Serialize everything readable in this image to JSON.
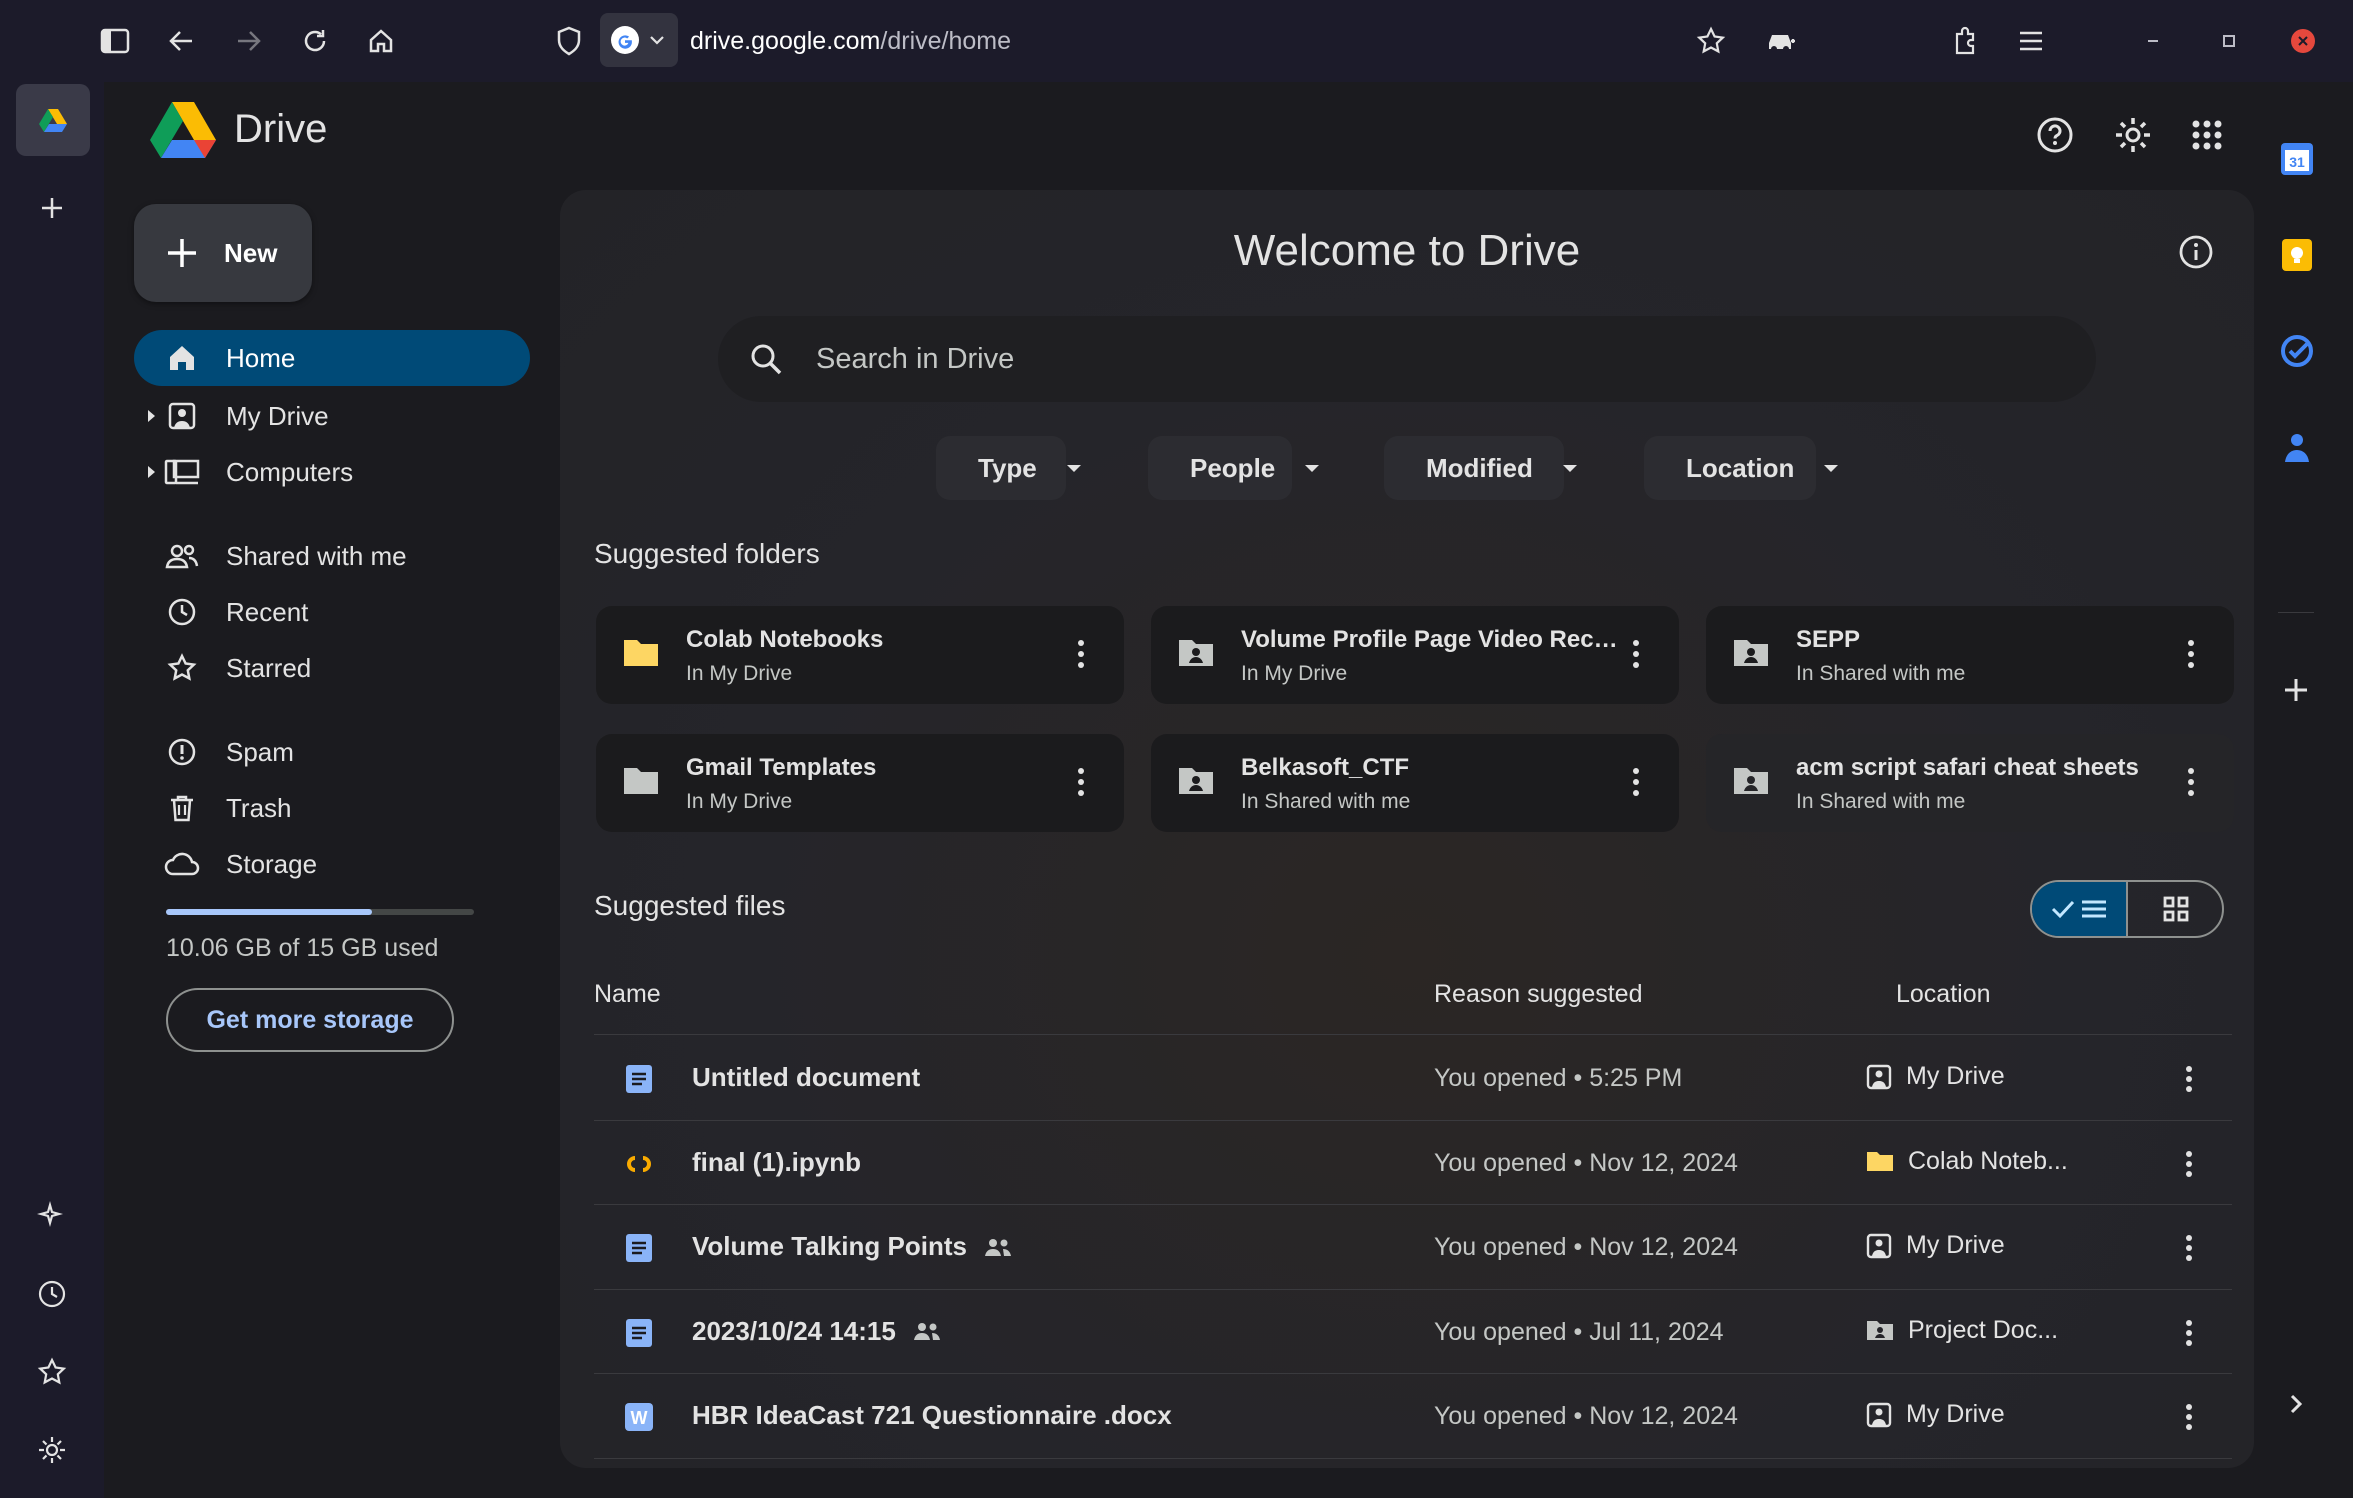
{
  "browser": {
    "url_host": "drive.google.com",
    "url_path": "/drive/home"
  },
  "app": {
    "title": "Drive"
  },
  "new_button": {
    "label": "New"
  },
  "nav": {
    "home": "Home",
    "my_drive": "My Drive",
    "computers": "Computers",
    "shared": "Shared with me",
    "recent": "Recent",
    "starred": "Starred",
    "spam": "Spam",
    "trash": "Trash",
    "storage": "Storage"
  },
  "storage": {
    "used_text": "10.06 GB of 15 GB used",
    "used_fraction": 0.67,
    "button": "Get more storage"
  },
  "main": {
    "welcome": "Welcome to Drive",
    "search_placeholder": "Search in Drive",
    "filters": [
      "Type",
      "People",
      "Modified",
      "Location"
    ],
    "suggested_folders_title": "Suggested folders",
    "suggested_files_title": "Suggested files"
  },
  "folders": [
    {
      "name": "Colab Notebooks",
      "location": "In My Drive",
      "icon": "folder-yellow-icon"
    },
    {
      "name": "Volume Profile Page Video Record...",
      "location": "In My Drive",
      "icon": "shared-folder-icon"
    },
    {
      "name": "SEPP",
      "location": "In Shared with me",
      "icon": "shared-folder-icon"
    },
    {
      "name": "Gmail Templates",
      "location": "In My Drive",
      "icon": "folder-icon"
    },
    {
      "name": "Belkasoft_CTF",
      "location": "In Shared with me",
      "icon": "shared-folder-icon"
    },
    {
      "name": "acm script safari cheat sheets",
      "location": "In Shared with me",
      "icon": "shared-folder-icon"
    }
  ],
  "table": {
    "headers": {
      "name": "Name",
      "reason": "Reason suggested",
      "location": "Location"
    },
    "rows": [
      {
        "name": "Untitled document",
        "reason": "You opened • 5:25 PM",
        "location": "My Drive",
        "type": "doc",
        "shared": false,
        "loc_icon": "my-drive-icon"
      },
      {
        "name": "final (1).ipynb",
        "reason": "You opened • Nov 12, 2024",
        "location": "Colab Noteb...",
        "type": "colab",
        "shared": false,
        "loc_icon": "folder-yellow-icon"
      },
      {
        "name": "Volume Talking Points",
        "reason": "You opened • Nov 12, 2024",
        "location": "My Drive",
        "type": "doc",
        "shared": true,
        "loc_icon": "my-drive-icon"
      },
      {
        "name": "2023/10/24 14:15",
        "reason": "You opened • Jul 11, 2024",
        "location": "Project Doc...",
        "type": "doc",
        "shared": true,
        "loc_icon": "shared-folder-icon"
      },
      {
        "name": "HBR IdeaCast 721 Questionnaire .docx",
        "reason": "You opened • Nov 12, 2024",
        "location": "My Drive",
        "type": "word",
        "shared": false,
        "loc_icon": "my-drive-icon"
      }
    ]
  },
  "colors": {
    "accent": "#004a77",
    "accent_text": "#a8c7fa",
    "doc_blue": "#8ab4f8",
    "colab_orange": "#f9ab00",
    "folder_yellow": "#fdd663"
  }
}
